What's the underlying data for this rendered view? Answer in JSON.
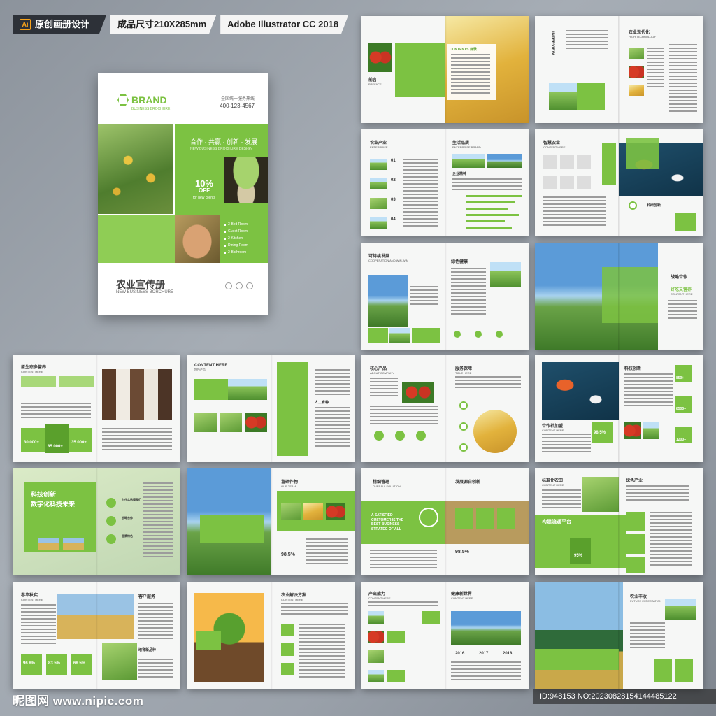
{
  "header": {
    "tag1": "原创画册设计",
    "tag2": "成品尺寸210X285mm",
    "tag3": "Adobe Illustrator CC 2018",
    "ai_badge": "Ai"
  },
  "cover": {
    "brand": "BRAND",
    "brand_sub": "BUSINESS BROCHURE",
    "hotline_label": "全国统一服务热线",
    "hotline": "400-123-4567",
    "slogan": "合作 · 共赢 · 创新 · 发展",
    "slogan_sub": "NEW BUSINESS BROCHURE DESIGN",
    "offer_pct": "10%",
    "offer_word": "OFF",
    "offer_note": "for new clients",
    "rooms": [
      "3-Bed Room",
      "Guest Room",
      "2-Kitchen",
      "Dining Room",
      "2-Bathroom"
    ],
    "title": "农业宣传册",
    "title_sub": "NEW BUSINESS BORCHURE"
  },
  "spreads": {
    "s1_title": "前言",
    "s1_sub": "PREFACE",
    "s1_contents": "CONTENTS 目录",
    "s2_title": "合作共赢·创新发展",
    "s2_sub": "INTERVIEW",
    "s2_right": "农业现代化",
    "s2_right_sub": "HIGH TECHNOLOGY",
    "s2_items": [
      "Art Director",
      "Art Director",
      "Art Director"
    ],
    "s3_title": "农业产业",
    "s3_sub": "ENTERPRISE",
    "s3_right": "生活品质",
    "s3_right_sub": "ENTERPRISE BRAND",
    "s3_nums": [
      "01",
      "02",
      "03",
      "04"
    ],
    "s3_mid": "企业精神",
    "s4_title": "智慧农业",
    "s4_sub": "CONTENT HERE",
    "s4_right": "科研创新",
    "s5_title": "可持续发展",
    "s5_sub": "COOPERATION AND WIN-WIN",
    "s5_right": "绿色健康",
    "s6_title": "战略合作",
    "s6_right": "好吃又营养",
    "s6_sub": "CONTENT HERE",
    "s7_title": "原生态多营养",
    "s7_sub": "CONTENT HERE",
    "s7_stat1": "30.000+",
    "s7_stat2": "85.000+",
    "s7_stat3": "35.000+",
    "s8_title": "特色产品",
    "s8_sub": "CONTENT HERE",
    "s8_right": "人工育种",
    "s9_title": "核心产品",
    "s9_sub": "ABOUT COMPANY",
    "s9_right": "服务保障",
    "s9_right_sub": "TIELE HERE",
    "s10_title": "科技创新",
    "s10_right": "合作社加盟",
    "s10_sub": "CONTENT HERE",
    "s10_pct": "98.5%",
    "s10_stats": [
      "850+",
      "8500+",
      "1200+"
    ],
    "s11_line1": "科技创新",
    "s11_line2": "数字化科技未来",
    "s11_items": [
      "为什么选择我们",
      "战略合作",
      "品牌特色"
    ],
    "s12_title": "富硒作物",
    "s12_sub": "OUR TEAM",
    "s12_pct": "98.5%",
    "s13_title": "精细管理",
    "s13_sub": "OVERALL SOLUTION",
    "s13_right": "发展源自创新",
    "s13_slogan": "A SATISFIED CUSTOMER IS THE BEST BUSINESS STRATEG OF ALL",
    "s13_pct": "98.5%",
    "s14_title": "标准化农田",
    "s14_sub": "CONTENT HERE",
    "s14_right": "绿色产业",
    "s14_band": "构建流通平台",
    "s14_pct": "95%",
    "s15_title": "春华秋实",
    "s15_sub": "CONTENT HERE",
    "s15_right": "客户服务",
    "s15_right2": "培育新品种",
    "s15_stats": [
      "96.8%",
      "83.5%",
      "68.5%"
    ],
    "s16_title": "农业解决方案",
    "s16_sub": "CONTENT HERE",
    "s17_title": "产出能力",
    "s17_sub": "CONTENT HERE",
    "s17_right": "健康新世界",
    "s17_right_sub": "CONTENT HERE",
    "s17_years": [
      "2016",
      "2017",
      "2018"
    ],
    "s18_title": "农业丰收",
    "s18_sub": "FUTURE EXPECTATION"
  },
  "footer": {
    "site": "昵图网 www.nipic.com",
    "id": "ID:948153 NO:20230828154144485122"
  }
}
